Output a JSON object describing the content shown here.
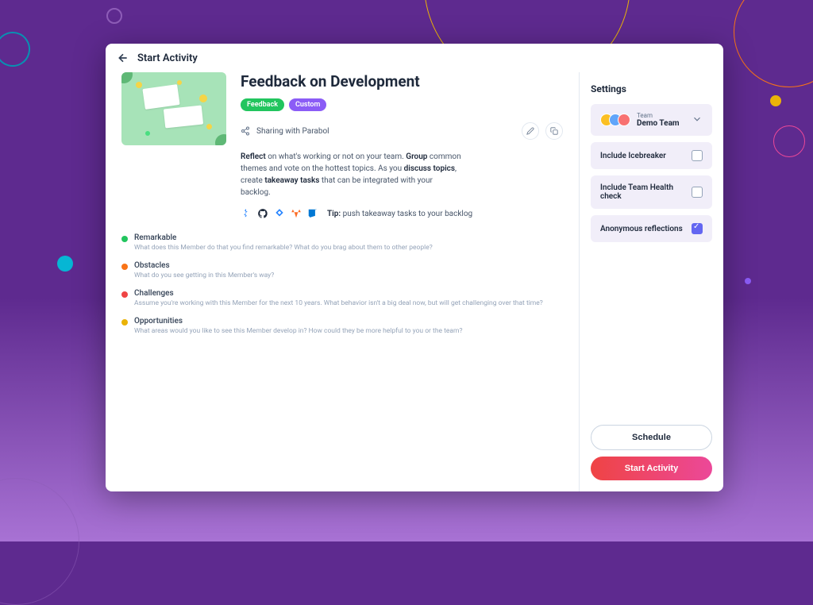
{
  "header": {
    "title": "Start Activity"
  },
  "main": {
    "title": "Feedback on Development",
    "tags": [
      {
        "label": "Feedback"
      },
      {
        "label": "Custom"
      }
    ],
    "sharing": "Sharing with Parabol",
    "description_parts": {
      "p1": "Reflect",
      "p2": " on what's working or not on your team. ",
      "p3": "Group",
      "p4": " common themes and vote on the hottest topics. As you ",
      "p5": "discuss topics",
      "p6": ", create ",
      "p7": "takeaway tasks",
      "p8": " that can be integrated with your backlog."
    },
    "tip": {
      "label": "Tip:",
      "text": " push takeaway tasks to your backlog"
    },
    "integrations": [
      "jira",
      "github",
      "jira-blue",
      "gitlab",
      "azure"
    ],
    "prompts": [
      {
        "color": "green",
        "title": "Remarkable",
        "description": "What does this Member do that you find remarkable? What do you brag about them to other people?"
      },
      {
        "color": "orange",
        "title": "Obstacles",
        "description": "What do you see getting in this Member's way?"
      },
      {
        "color": "red",
        "title": "Challenges",
        "description": "Assume you're working with this Member for the next 10 years. What behavior isn't a big deal now, but will get challenging over that time?"
      },
      {
        "color": "yellow",
        "title": "Opportunities",
        "description": "What areas would you like to see this Member develop in? How could they be more helpful to you or the team?"
      }
    ]
  },
  "sidebar": {
    "title": "Settings",
    "team": {
      "label": "Team",
      "name": "Demo Team"
    },
    "options": [
      {
        "label": "Include Icebreaker",
        "checked": false
      },
      {
        "label": "Include Team Health check",
        "checked": false
      },
      {
        "label": "Anonymous reflections",
        "checked": true
      }
    ],
    "buttons": {
      "schedule": "Schedule",
      "start": "Start Activity"
    }
  }
}
